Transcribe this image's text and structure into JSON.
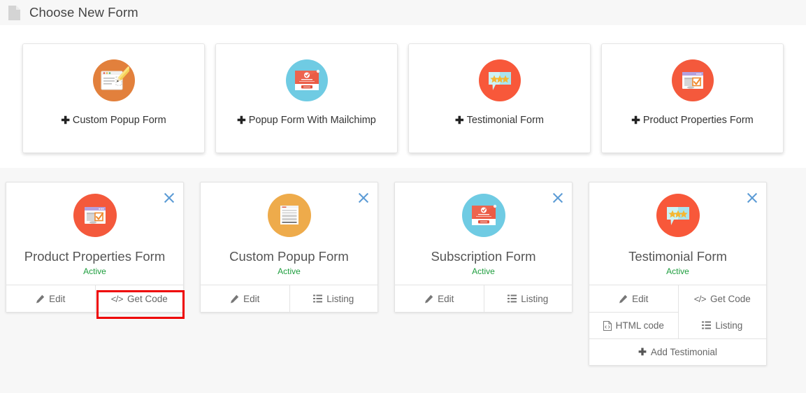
{
  "header": {
    "icon": "page-icon",
    "title": "Choose New Form"
  },
  "new_forms": {
    "plus": "✚",
    "items": [
      {
        "label": "Custom Popup Form",
        "icon": "popup-form-pencil-icon",
        "circle_color": "#e2803c"
      },
      {
        "label": "Popup Form With Mailchimp",
        "icon": "mailchimp-popup-icon",
        "circle_color": "#6fcbe3"
      },
      {
        "label": "Testimonial Form",
        "icon": "testimonial-stars-icon",
        "circle_color": "#f8583a"
      },
      {
        "label": "Product Properties Form",
        "icon": "product-properties-icon",
        "circle_color": "#f4593c"
      }
    ]
  },
  "forms": [
    {
      "name": "Product Properties Form",
      "status": "Active",
      "icon": "product-properties-icon",
      "circle_color": "#f4593c",
      "close_label": "×",
      "actions": [
        {
          "label": "Edit",
          "icon": "pencil-icon"
        },
        {
          "label": "Get Code",
          "icon": "code-icon",
          "highlighted": true
        }
      ]
    },
    {
      "name": "Custom Popup Form",
      "status": "Active",
      "icon": "document-lines-icon",
      "circle_color": "#eeab4b",
      "close_label": "×",
      "actions": [
        {
          "label": "Edit",
          "icon": "pencil-icon"
        },
        {
          "label": "Listing",
          "icon": "list-icon"
        }
      ]
    },
    {
      "name": "Subscription Form",
      "status": "Active",
      "icon": "mailchimp-popup-icon",
      "circle_color": "#6fcbe3",
      "close_label": "×",
      "actions": [
        {
          "label": "Edit",
          "icon": "pencil-icon"
        },
        {
          "label": "Listing",
          "icon": "list-icon"
        }
      ]
    },
    {
      "name": "Testimonial Form",
      "status": "Active",
      "icon": "testimonial-stars-icon",
      "circle_color": "#f8583a",
      "close_label": "×",
      "actions": [
        {
          "label": "Edit",
          "icon": "pencil-icon"
        },
        {
          "label": "Get Code",
          "icon": "code-icon"
        },
        {
          "label": "HTML code",
          "icon": "html-file-icon"
        },
        {
          "label": "Listing",
          "icon": "list-icon"
        },
        {
          "label": "Add Testimonial",
          "icon": "plus-icon"
        }
      ]
    }
  ],
  "colors": {
    "highlight": "#ee0000",
    "active_text": "#1e9e3e",
    "close_icon": "#5b9bd5",
    "page_bg": "#ffffff",
    "list_bg": "#f7f7f7",
    "header_bg": "#f7f7f7"
  }
}
